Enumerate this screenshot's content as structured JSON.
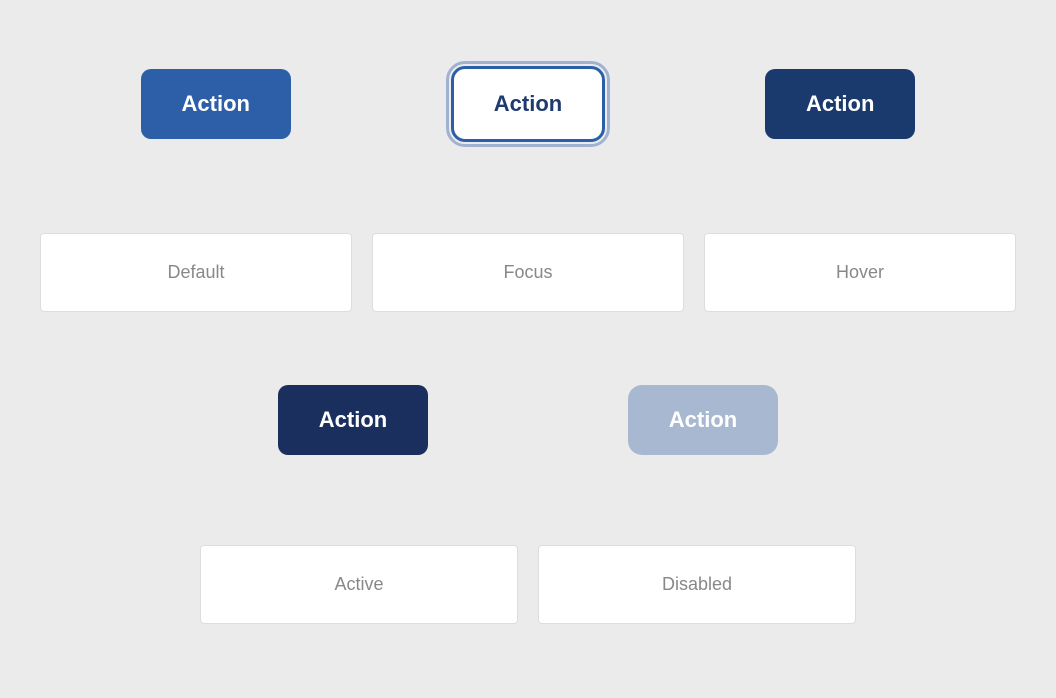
{
  "row1": {
    "btn_default_label": "Action",
    "btn_focus_label": "Action",
    "btn_hover_label": "Action"
  },
  "row2": {
    "label_default": "Default",
    "label_focus": "Focus",
    "label_hover": "Hover"
  },
  "row3": {
    "btn_active_label": "Action",
    "btn_disabled_label": "Action"
  },
  "row4": {
    "label_active": "Active",
    "label_disabled": "Disabled"
  },
  "colors": {
    "bg": "#ebebeb",
    "btn_default": "#2d5fa8",
    "btn_hover": "#1a3a6e",
    "btn_active": "#1a2f5e",
    "btn_disabled": "#a8b8d0",
    "btn_focus_border": "#2d5fa8",
    "label_text": "#888888",
    "white": "#ffffff"
  }
}
